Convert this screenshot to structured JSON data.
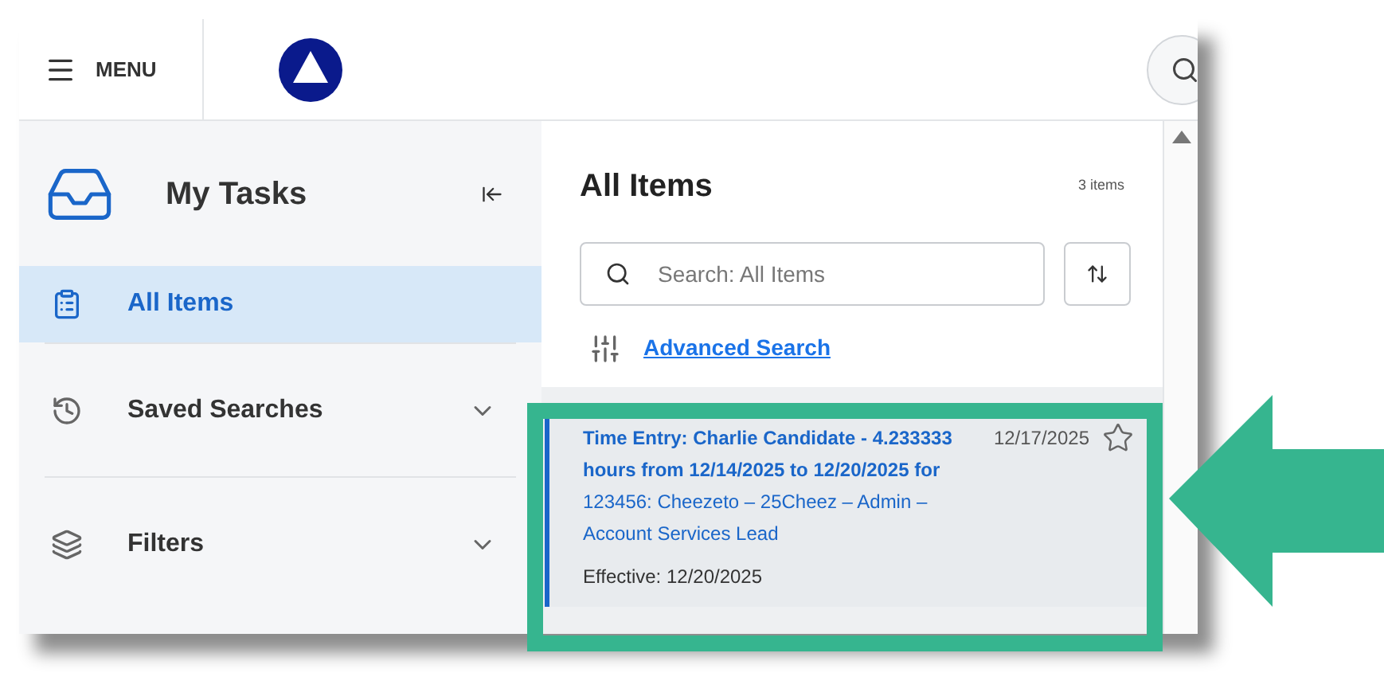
{
  "header": {
    "menu_label": "MENU"
  },
  "sidebar": {
    "title": "My Tasks",
    "items": [
      {
        "label": "All Items",
        "selected": true,
        "kind": "link"
      },
      {
        "label": "Saved Searches",
        "selected": false,
        "kind": "expandable"
      },
      {
        "label": "Filters",
        "selected": false,
        "kind": "expandable"
      }
    ]
  },
  "main": {
    "title": "All Items",
    "count": "3 items",
    "search": {
      "placeholder": "Search: All Items"
    },
    "advanced_search": "Advanced Search",
    "items": [
      {
        "title": "**Time Entry: Charlie Candidate - 4.233333 hours from 12/14/2025 to 12/20/2025 for** 123456:  Cheezeto – 25Cheez – Admin – Account  Services Lead",
        "date": "12/17/2025",
        "effective": "Effective: 12/20/2025",
        "starred": false,
        "highlighted": true
      }
    ]
  }
}
